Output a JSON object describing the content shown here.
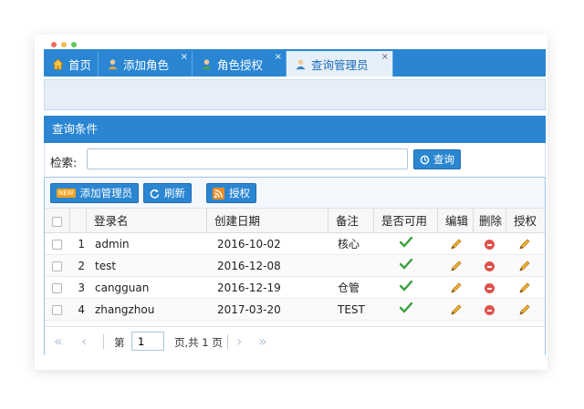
{
  "tabs": [
    {
      "label": "首页",
      "icon": "home-icon"
    },
    {
      "label": "添加角色",
      "icon": "user-icon"
    },
    {
      "label": "角色授权",
      "icon": "user-icon"
    },
    {
      "label": "查询管理员",
      "icon": "user-icon"
    }
  ],
  "close_symbol": "×",
  "panel": {
    "title": "查询条件"
  },
  "search": {
    "label": "检索:",
    "value": "",
    "button": "查询"
  },
  "toolbar": {
    "add_admin": "添加管理员",
    "add_badge": "NEW",
    "refresh": "刷新",
    "authorize": "授权"
  },
  "table": {
    "columns": [
      "登录名",
      "创建日期",
      "备注",
      "是否可用",
      "编辑",
      "删除",
      "授权"
    ],
    "rows": [
      {
        "n": "1",
        "login": "admin",
        "date": "2016-10-02",
        "note": "核心"
      },
      {
        "n": "2",
        "login": "test",
        "date": "2016-12-08",
        "note": ""
      },
      {
        "n": "3",
        "login": "cangguan",
        "date": "2016-12-19",
        "note": "仓管"
      },
      {
        "n": "4",
        "login": "zhangzhou",
        "date": "2017-03-20",
        "note": "TEST"
      }
    ]
  },
  "pager": {
    "first": "«",
    "prev": "‹",
    "next": "›",
    "last": "»",
    "page_prefix": "第",
    "page_value": "1",
    "page_suffix": "页,共 1 页"
  },
  "colors": {
    "accent": "#2a86d3",
    "ok": "#3aa13a",
    "delete": "#e0514a"
  }
}
